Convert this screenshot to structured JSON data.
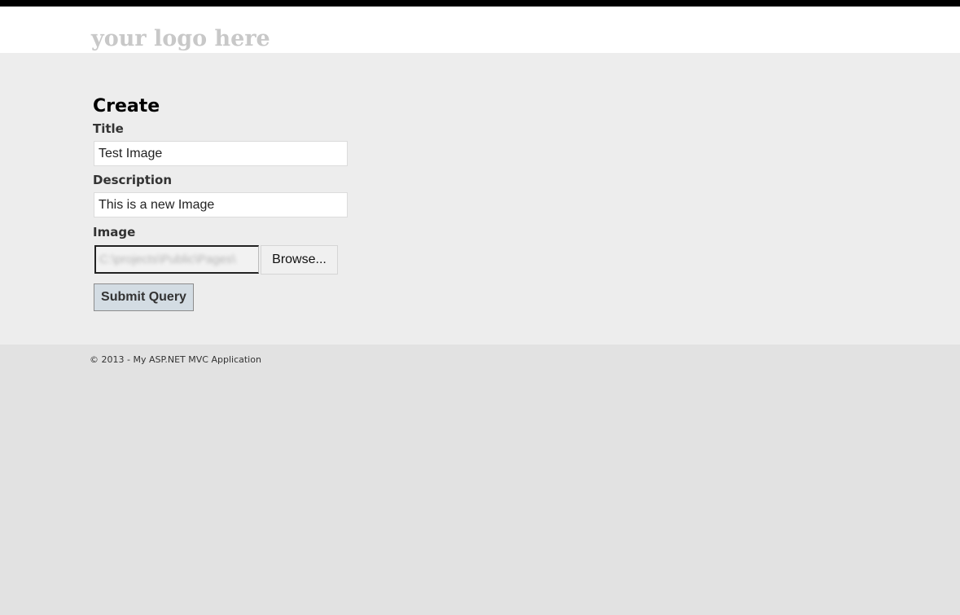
{
  "header": {
    "logo_text": "your logo here"
  },
  "main": {
    "page_title": "Create",
    "fields": {
      "title": {
        "label": "Title",
        "value": "Test Image"
      },
      "description": {
        "label": "Description",
        "value": "This is a new Image"
      },
      "image": {
        "label": "Image",
        "file_path": "C:\\projects\\Public\\Pages\\",
        "browse_label": "Browse..."
      }
    },
    "submit_label": "Submit Query"
  },
  "footer": {
    "text": "© 2013 - My ASP.NET MVC Application"
  },
  "colors": {
    "top_bar": "#000000",
    "header_bg": "#ffffff",
    "main_bg": "#ededed",
    "footer_bg": "#e2e2e2",
    "submit_bg": "#d3dce3"
  }
}
